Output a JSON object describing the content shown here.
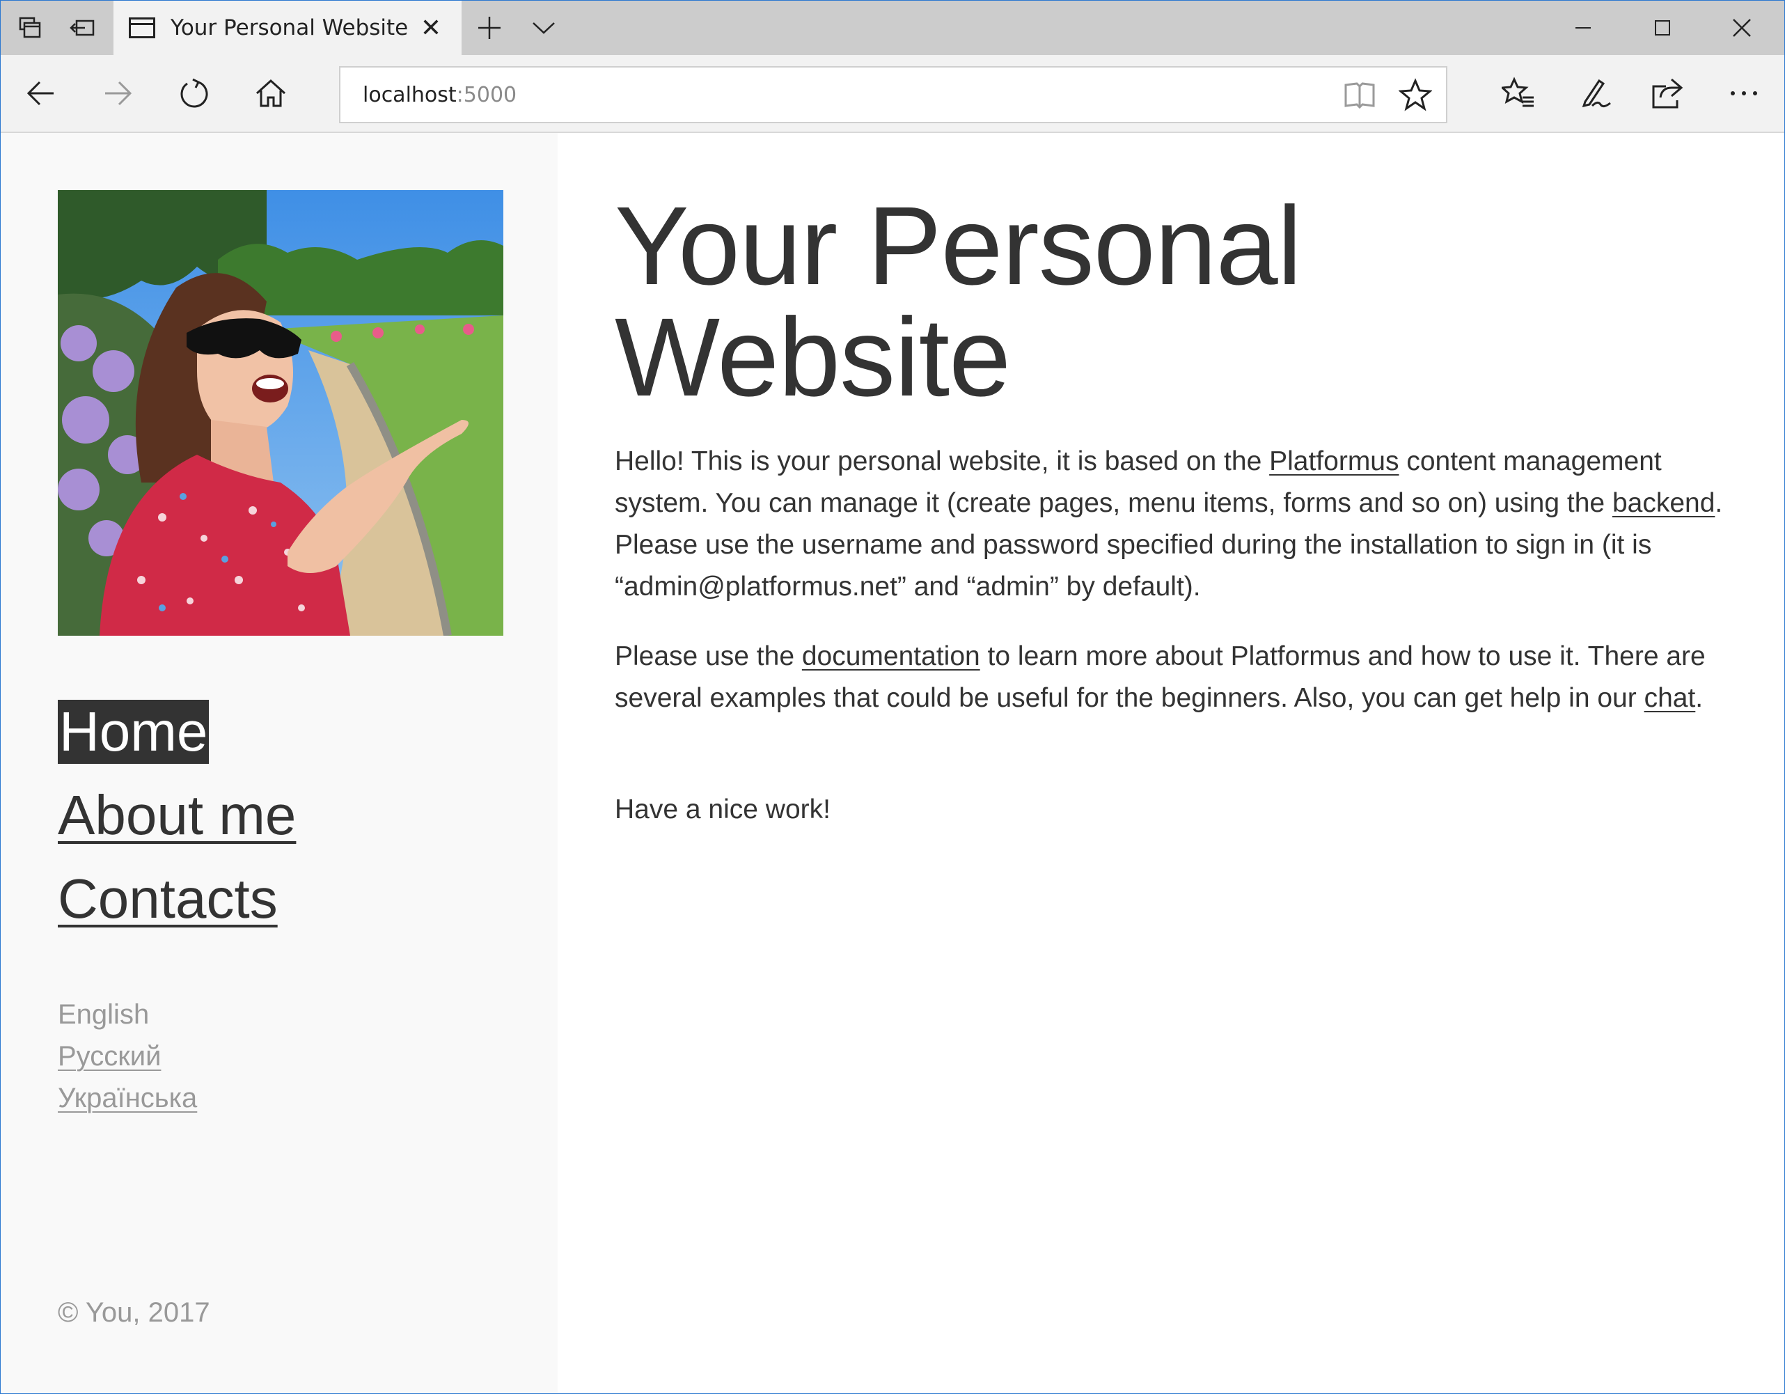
{
  "browser": {
    "tab_title": "Your Personal Website",
    "url_host": "localhost",
    "url_port": ":5000",
    "icons": {
      "tab_actions": "tab-preview-icon",
      "set_aside": "set-aside-tabs-icon",
      "favicon": "page-favicon-icon",
      "tab_close": "close-icon",
      "new_tab": "plus-icon",
      "tab_dropdown": "chevron-down-icon",
      "back": "back-arrow-icon",
      "forward": "forward-arrow-icon",
      "refresh": "refresh-icon",
      "home": "home-icon",
      "reading_view": "book-icon",
      "favorite": "star-icon",
      "favorites_hub": "favorites-list-icon",
      "web_note": "pen-icon",
      "share": "share-icon",
      "more": "more-dots-icon"
    }
  },
  "sidebar": {
    "menu": [
      {
        "label": "Home",
        "active": true
      },
      {
        "label": "About me",
        "active": false
      },
      {
        "label": "Contacts",
        "active": false
      }
    ],
    "languages": [
      {
        "label": "English",
        "current": true
      },
      {
        "label": "Русский",
        "current": false
      },
      {
        "label": "Українська",
        "current": false
      }
    ],
    "copyright": "© You, 2017"
  },
  "main": {
    "title_line1": "Your Personal",
    "title_line2": "Website",
    "p1": {
      "t1": "Hello! This is your personal website, it is based on the ",
      "link1": "Platformus",
      "t2": " content management system. You can manage it (create pages, menu items, forms and so on) using the ",
      "link2": "backend",
      "t3": ". Please use the username and password specified during the installation to sign in (it is “admin@platformus.net” and “admin” by default)."
    },
    "p2": {
      "t1": "Please use the ",
      "link1": "documentation",
      "t2": " to learn more about Platformus and how to use it. There are several examples that could be useful for the beginners. Also, you can get help in our ",
      "link2": "chat",
      "t3": "."
    },
    "p3": "Have a nice work!"
  },
  "colors": {
    "text": "#333333",
    "muted": "#999999",
    "sidebar_bg": "#f9f9f9",
    "chrome_bg": "#f2f2f2",
    "tabstrip_bg": "#cccccc"
  }
}
